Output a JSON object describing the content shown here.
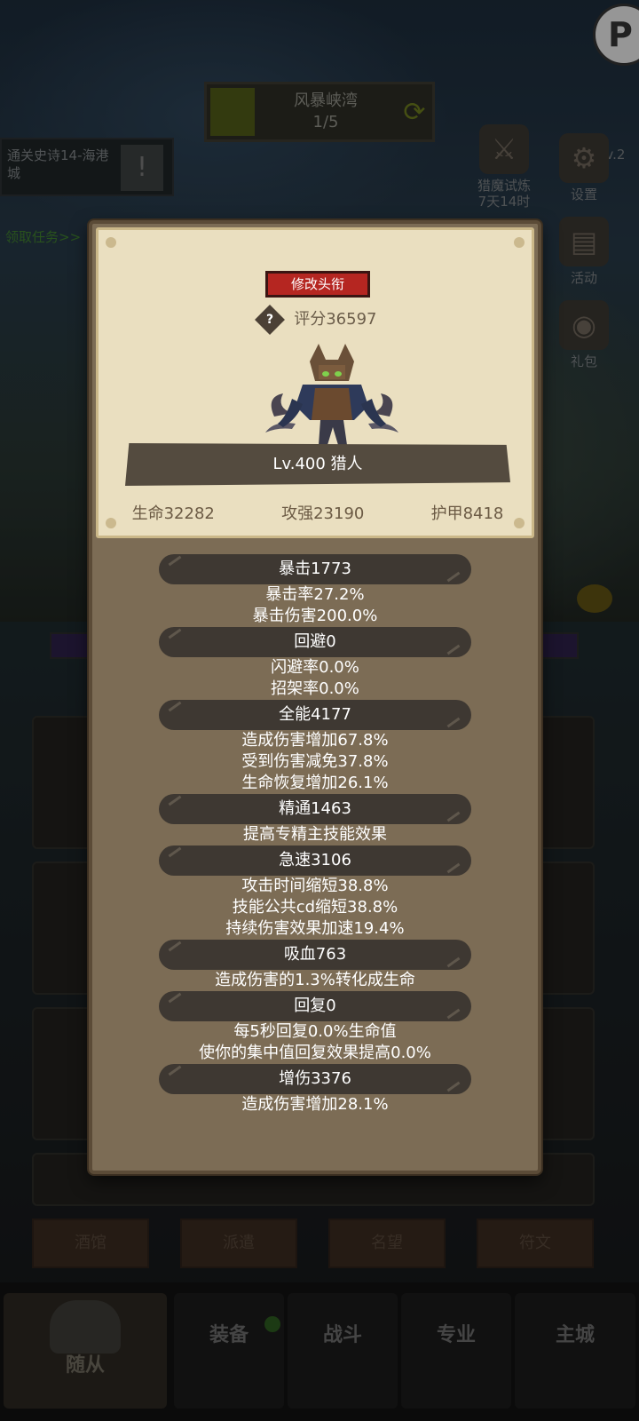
{
  "hud": {
    "map_name": "风暴峡湾",
    "map_progress": "1/5",
    "quest_text": "通关史诗14-海港城",
    "quest_mark": "!",
    "claim_link": "领取任务>>",
    "top_right_glyph": "P",
    "lv_top": "Lv.2",
    "event_title": "猎魔试炼",
    "event_time": "7天14时",
    "settings_label": "设置",
    "activity_label": "活动",
    "gift_label": "礼包"
  },
  "bottom_buttons": [
    "酒馆",
    "派遣",
    "名望",
    "符文"
  ],
  "tabs": [
    "随从",
    "装备",
    "战斗",
    "专业",
    "主城"
  ],
  "modal": {
    "title_button": "修改头衔",
    "help_glyph": "?",
    "score": "评分36597",
    "level_banner": "Lv.400 猎人",
    "stats": [
      "生命32282",
      "攻强23190",
      "护甲8418"
    ],
    "attributes": [
      {
        "header": "暴击1773",
        "lines": [
          "暴击率27.2%",
          "暴击伤害200.0%"
        ]
      },
      {
        "header": "回避0",
        "lines": [
          "闪避率0.0%",
          "招架率0.0%"
        ]
      },
      {
        "header": "全能4177",
        "lines": [
          "造成伤害增加67.8%",
          "受到伤害减免37.8%",
          "生命恢复增加26.1%"
        ]
      },
      {
        "header": "精通1463",
        "lines": [
          "提高专精主技能效果"
        ]
      },
      {
        "header": "急速3106",
        "lines": [
          "攻击时间缩短38.8%",
          "技能公共cd缩短38.8%",
          "持续伤害效果加速19.4%"
        ]
      },
      {
        "header": "吸血763",
        "lines": [
          "造成伤害的1.3%转化成生命"
        ]
      },
      {
        "header": "回复0",
        "lines": [
          "每5秒回复0.0%生命值",
          "使你的集中值回复效果提高0.0%"
        ]
      },
      {
        "header": "增伤3376",
        "lines": [
          "造成伤害增加28.1%"
        ]
      }
    ]
  },
  "colors": {
    "modal_bg": "#7c6c55",
    "parchment": "#eadfc0",
    "title_button_red": "#b52621",
    "header_pill": "#3e3832"
  }
}
